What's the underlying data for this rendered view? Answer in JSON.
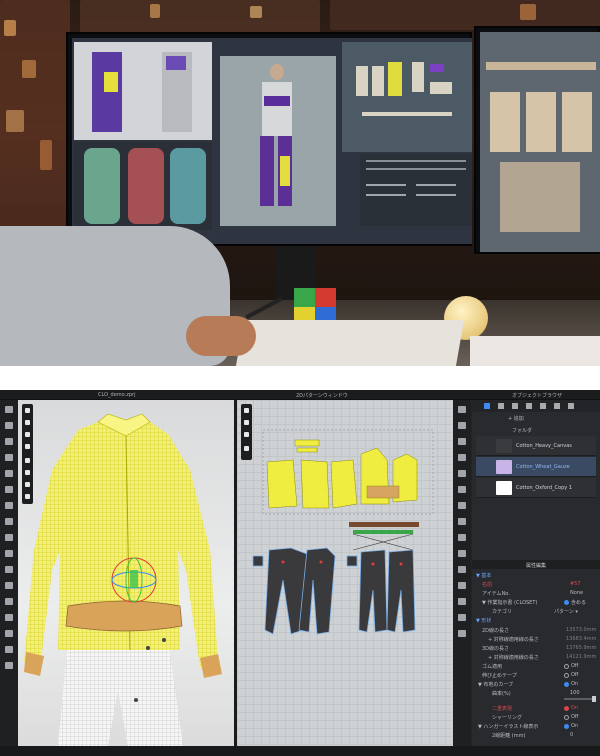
{
  "app": {
    "file_tab": "CLO_demo.zprj",
    "pattern_window_title": "2Dパターンウィンドウ",
    "object_browser_title": "オブジェクトブラウザ",
    "add_label": "+ 追加",
    "folder_label": "フォルダ",
    "fabrics": [
      {
        "name": "Cotton_Heavy_Canvas",
        "swatch": "#3a3b3e",
        "selected": false
      },
      {
        "name": "Cotton_Wheat_Gauze",
        "swatch": "#c8b4e6",
        "selected": true
      },
      {
        "name": "Cotton_Oxford_Copy 1",
        "swatch": "#ffffff",
        "selected": false
      }
    ],
    "property_editor_title": "属性編集",
    "basic_section": "▼ 基本",
    "rows": [
      {
        "label": "名前",
        "value": "#57",
        "red": true
      },
      {
        "label": "アイテムNo.",
        "value": "None"
      },
      {
        "label": "▼ 作業指示書 (CLOSET)",
        "value": "含める",
        "toggle": "on"
      },
      {
        "label": "カテゴリ",
        "value": "パターン ▾"
      }
    ],
    "shape_section": "▼ 形状",
    "shape_rows": [
      {
        "label": "2D線の長さ",
        "value": "13573.0mm"
      },
      {
        "label": "+ 対称線適用線の長さ",
        "value": "13683.4mm"
      },
      {
        "label": "3D線の長さ",
        "value": "13765.9mm"
      },
      {
        "label": "+ 対称線適用線の長さ",
        "value": "14121.9mm"
      },
      {
        "label": "ゴム適用",
        "value": "Off",
        "toggle": "off"
      },
      {
        "label": "伸び止めテープ",
        "value": "Off",
        "toggle": "off"
      },
      {
        "label": "▼ 布地のカーブ",
        "value": "On",
        "toggle": "on"
      },
      {
        "label": "曲率(%)",
        "value": "100"
      },
      {
        "label": "二重表現",
        "value": "On",
        "toggle": "red",
        "red": true
      },
      {
        "label": "シャーリング",
        "value": "Off",
        "toggle": "off"
      },
      {
        "label": "▼ ハンガーイラスト線表示",
        "value": "On",
        "toggle": "on"
      },
      {
        "label": "2線距離 (mm)",
        "value": "0"
      }
    ]
  },
  "accent_color": "#3d8bf2",
  "garment_color": "#f2ef3a"
}
